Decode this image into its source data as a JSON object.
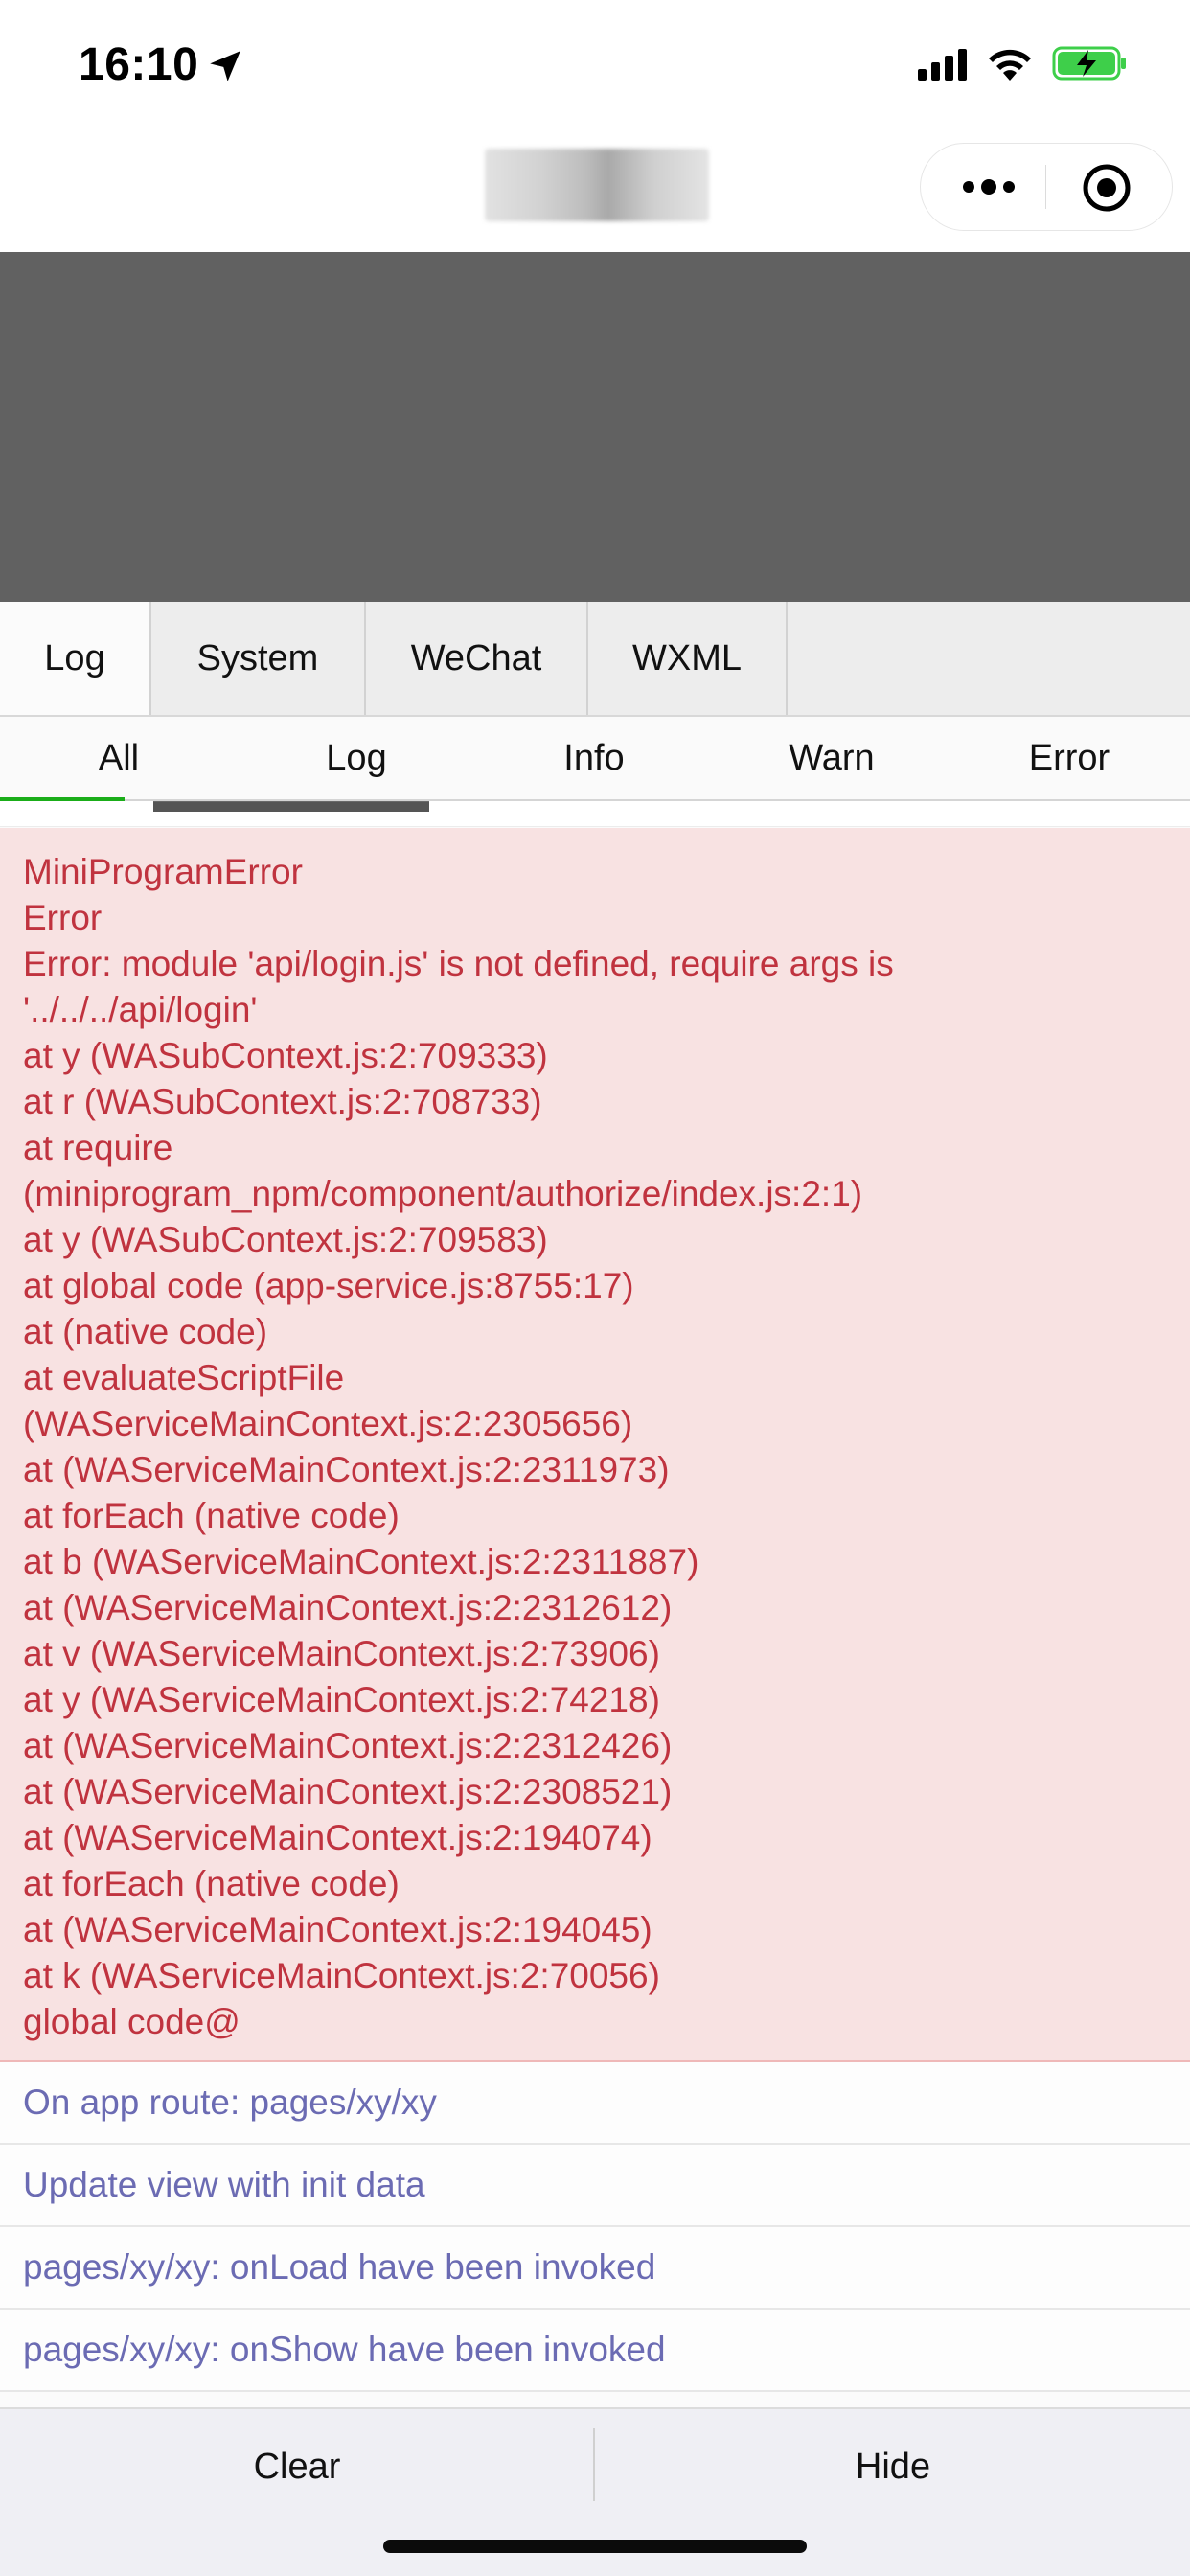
{
  "status_bar": {
    "time": "16:10",
    "icons": [
      "location-arrow-icon",
      "cellular-signal-icon",
      "wifi-icon",
      "battery-charging-icon"
    ],
    "battery_color": "#3ecf4a"
  },
  "nav": {
    "title": "",
    "capsule_icons": [
      "more-icon",
      "close-target-icon"
    ]
  },
  "console": {
    "tabs": [
      {
        "label": "Log"
      },
      {
        "label": "System"
      },
      {
        "label": "WeChat"
      },
      {
        "label": "WXML"
      }
    ],
    "subtabs": [
      {
        "label": "All"
      },
      {
        "label": "Log"
      },
      {
        "label": "Info"
      },
      {
        "label": "Warn"
      },
      {
        "label": "Error"
      }
    ],
    "error_lines": [
      "MiniProgramError",
      "Error",
      "Error: module 'api/login.js' is not defined, require args is",
      "'../../../api/login'",
      "at y (WASubContext.js:2:709333)",
      "at r (WASubContext.js:2:708733)",
      "at require",
      "(miniprogram_npm/component/authorize/index.js:2:1)",
      "at y (WASubContext.js:2:709583)",
      "at global code (app-service.js:8755:17)",
      "at (native code)",
      "at evaluateScriptFile",
      "(WAServiceMainContext.js:2:2305656)",
      "at (WAServiceMainContext.js:2:2311973)",
      "at forEach (native code)",
      "at b (WAServiceMainContext.js:2:2311887)",
      "at (WAServiceMainContext.js:2:2312612)",
      "at v (WAServiceMainContext.js:2:73906)",
      "at y (WAServiceMainContext.js:2:74218)",
      "at (WAServiceMainContext.js:2:2312426)",
      "at (WAServiceMainContext.js:2:2308521)",
      "at (WAServiceMainContext.js:2:194074)",
      "at forEach (native code)",
      "at (WAServiceMainContext.js:2:194045)",
      "at k (WAServiceMainContext.js:2:70056)",
      "global code@"
    ],
    "log_rows": [
      "On app route: pages/xy/xy",
      "Update view with init data",
      "pages/xy/xy: onLoad have been invoked",
      "pages/xy/xy: onShow have been invoked"
    ],
    "footer": {
      "clear_label": "Clear",
      "hide_label": "Hide"
    },
    "colors": {
      "error_text": "#c0333f",
      "error_bg": "#f8e2e2",
      "log_text": "#6b6bb3",
      "active_subtab": "#1aad19"
    }
  }
}
